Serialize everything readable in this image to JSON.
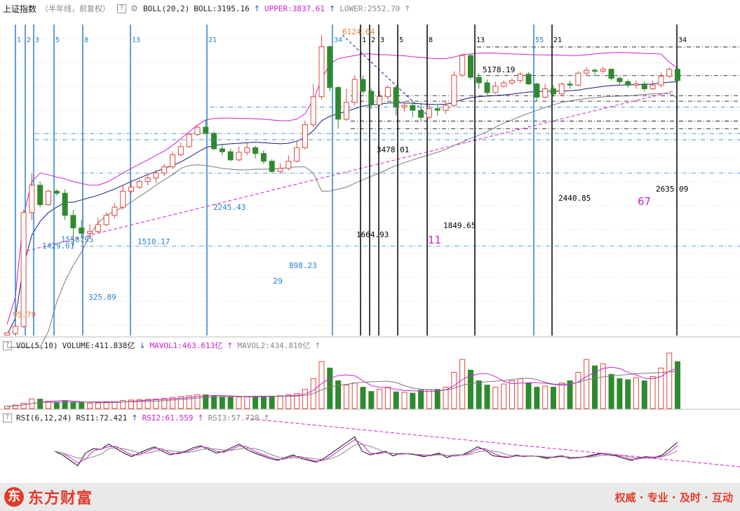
{
  "main_header": {
    "title": "上证指数",
    "subtitle": "（半年线，前复权）",
    "help": "?",
    "indicator": "BOLL(20,2)",
    "boll": "BOLL:3195.16",
    "upper": "UPPER:3837.61",
    "lower": "LOWER:2552.70"
  },
  "vol_header": {
    "help": "?",
    "indicator": "VOL(5,10)",
    "volume": "VOLUME:411.838亿",
    "mavol1": "MAVOL1:463.613亿",
    "mavol2": "MAVOL2:434.810亿"
  },
  "rsi_header": {
    "help": "?",
    "indicator": "RSI(6,12,24)",
    "rsi1": "RSI1:72.421",
    "rsi2": "RSI2:61.559",
    "rsi3": "RSI3:57.728"
  },
  "footer": {
    "logo_mark": "东",
    "brand": "东方财富",
    "slogan": "权威 · 专业 · 及时 · 互动"
  },
  "colors": {
    "up": "#e0473d",
    "down": "#2f8a2f",
    "boll_mid": "#1a1a7a",
    "boll_upper": "#d01fd0",
    "boll_lower": "#7a7a7a",
    "fib_blue": "#2a7fd0",
    "fib_black": "#000000",
    "hline_cyan": "#2a7fd0",
    "trend_pink": "#d01fd0",
    "annot_red": "#e87a30"
  },
  "chart_data": {
    "type": "candlestick",
    "price_scale": [
      100,
      7000
    ],
    "candles": [
      [
        95,
        98,
        97,
        95,
        103
      ],
      [
        97,
        107,
        96,
        108,
        160
      ],
      [
        107,
        520,
        105,
        540,
        250
      ],
      [
        520,
        760,
        470,
        900,
        450
      ],
      [
        760,
        580,
        560,
        800,
        440
      ],
      [
        580,
        700,
        575,
        710,
        340
      ],
      [
        700,
        680,
        660,
        720,
        300
      ],
      [
        680,
        500,
        470,
        720,
        360
      ],
      [
        500,
        420,
        326,
        540,
        300
      ],
      [
        420,
        390,
        360,
        470,
        280
      ],
      [
        390,
        400,
        370,
        440,
        250
      ],
      [
        400,
        440,
        390,
        480,
        260
      ],
      [
        440,
        500,
        430,
        520,
        300
      ],
      [
        500,
        560,
        480,
        590,
        320
      ],
      [
        560,
        700,
        540,
        760,
        380
      ],
      [
        700,
        740,
        680,
        820,
        400
      ],
      [
        740,
        800,
        720,
        830,
        420
      ],
      [
        800,
        840,
        760,
        890,
        430
      ],
      [
        840,
        900,
        780,
        940,
        440
      ],
      [
        900,
        980,
        860,
        1020,
        470
      ],
      [
        980,
        1160,
        950,
        1210,
        520
      ],
      [
        1160,
        1300,
        1130,
        1380,
        560
      ],
      [
        1300,
        1540,
        1280,
        1580,
        600
      ],
      [
        1540,
        1700,
        1500,
        1760,
        650
      ],
      [
        1700,
        1560,
        1540,
        1900,
        640
      ],
      [
        1560,
        1260,
        1240,
        1600,
        590
      ],
      [
        1260,
        1210,
        1150,
        1330,
        560
      ],
      [
        1210,
        1080,
        1060,
        1260,
        530
      ],
      [
        1080,
        1200,
        1060,
        1300,
        540
      ],
      [
        1200,
        1280,
        1150,
        1360,
        550
      ],
      [
        1280,
        1180,
        1100,
        1310,
        560
      ],
      [
        1180,
        1060,
        1020,
        1240,
        580
      ],
      [
        1060,
        920,
        898,
        1090,
        580
      ],
      [
        920,
        960,
        890,
        1030,
        600
      ],
      [
        960,
        1060,
        930,
        1150,
        640
      ],
      [
        1060,
        1280,
        1040,
        1400,
        700
      ],
      [
        1280,
        1760,
        1250,
        1860,
        900
      ],
      [
        1760,
        2600,
        1700,
        3100,
        1400
      ],
      [
        2600,
        5200,
        2500,
        6124,
        2200
      ],
      [
        5200,
        2950,
        2800,
        5300,
        1900
      ],
      [
        2950,
        1900,
        1664,
        3000,
        1300
      ],
      [
        1900,
        2400,
        1850,
        2900,
        1100
      ],
      [
        2400,
        3300,
        2300,
        3500,
        1200
      ],
      [
        3300,
        2800,
        2700,
        3478,
        1000
      ],
      [
        2800,
        2320,
        2200,
        2900,
        800
      ],
      [
        2320,
        2600,
        2280,
        2800,
        900
      ],
      [
        2600,
        2950,
        2500,
        3050,
        1000
      ],
      [
        2950,
        2250,
        2000,
        3000,
        780
      ],
      [
        2250,
        2300,
        2100,
        2450,
        760
      ],
      [
        2300,
        2150,
        1950,
        2450,
        720
      ],
      [
        2150,
        1950,
        1850,
        2400,
        860
      ],
      [
        1950,
        2200,
        1900,
        2350,
        880
      ],
      [
        2200,
        2150,
        2000,
        2300,
        900
      ],
      [
        2150,
        2300,
        2050,
        2450,
        1000
      ],
      [
        2300,
        3500,
        2250,
        3700,
        1700
      ],
      [
        3500,
        4600,
        3400,
        4700,
        2300
      ],
      [
        4600,
        3400,
        3300,
        4700,
        1800
      ],
      [
        3400,
        3150,
        2900,
        3600,
        1300
      ],
      [
        3150,
        2750,
        2650,
        3300,
        1100
      ],
      [
        2750,
        3000,
        2700,
        3200,
        1000
      ],
      [
        3000,
        3150,
        2950,
        3250,
        1150
      ],
      [
        3150,
        3250,
        3050,
        3350,
        1300
      ],
      [
        3250,
        3550,
        3150,
        3650,
        1400
      ],
      [
        3550,
        3100,
        3050,
        3650,
        1200
      ],
      [
        3100,
        2580,
        2440,
        3150,
        1000
      ],
      [
        2580,
        2900,
        2550,
        3100,
        1050
      ],
      [
        2900,
        2700,
        2600,
        3050,
        1000
      ],
      [
        2700,
        3100,
        2650,
        3150,
        1200
      ],
      [
        3100,
        3050,
        2900,
        3250,
        1300
      ],
      [
        3050,
        3600,
        3000,
        3700,
        1700
      ],
      [
        3600,
        3750,
        3450,
        3900,
        2300
      ],
      [
        3750,
        3700,
        3450,
        3850,
        2000
      ],
      [
        3700,
        3800,
        3600,
        3950,
        2100
      ],
      [
        3800,
        3350,
        3250,
        3850,
        1600
      ],
      [
        3350,
        3200,
        3050,
        3450,
        1400
      ],
      [
        3200,
        3050,
        2950,
        3300,
        1350
      ],
      [
        3050,
        3100,
        2900,
        3250,
        1450
      ],
      [
        3100,
        2900,
        2800,
        3200,
        1300
      ],
      [
        2900,
        3050,
        2850,
        3250,
        1500
      ],
      [
        3050,
        3450,
        2950,
        3650,
        1900
      ],
      [
        3450,
        3800,
        3350,
        3900,
        2600
      ],
      [
        3800,
        3250,
        3200,
        3850,
        2200
      ]
    ],
    "boll_mid": [
      95,
      120,
      250,
      380,
      460,
      520,
      560,
      600,
      600,
      620,
      640,
      660,
      690,
      720,
      760,
      800,
      840,
      880,
      920,
      960,
      1000,
      1050,
      1120,
      1200,
      1280,
      1320,
      1340,
      1350,
      1360,
      1370,
      1380,
      1370,
      1360,
      1350,
      1360,
      1400,
      1480,
      1620,
      1860,
      1980,
      2050,
      2120,
      2200,
      2280,
      2320,
      2340,
      2380,
      2390,
      2380,
      2370,
      2350,
      2340,
      2330,
      2340,
      2400,
      2500,
      2560,
      2600,
      2620,
      2640,
      2660,
      2690,
      2730,
      2770,
      2790,
      2800,
      2800,
      2810,
      2820,
      2850,
      2900,
      2950,
      3000,
      3030,
      3050,
      3060,
      3070,
      3080,
      3100,
      3140,
      3180,
      3195
    ],
    "boll_upper": [
      110,
      160,
      500,
      800,
      900,
      880,
      850,
      830,
      800,
      780,
      760,
      760,
      790,
      840,
      900,
      960,
      1020,
      1080,
      1150,
      1220,
      1320,
      1450,
      1600,
      1750,
      1880,
      1920,
      1930,
      1930,
      1920,
      1920,
      1910,
      1900,
      1880,
      1860,
      1860,
      1900,
      2050,
      2500,
      3300,
      4100,
      4400,
      4500,
      4600,
      4700,
      4700,
      4650,
      4650,
      4600,
      4580,
      4520,
      4480,
      4430,
      4400,
      4400,
      4500,
      4650,
      4700,
      4750,
      4760,
      4750,
      4720,
      4700,
      4680,
      4660,
      4650,
      4640,
      4640,
      4620,
      4600,
      4600,
      4650,
      4700,
      4750,
      4780,
      4800,
      4780,
      4760,
      4740,
      4720,
      4700,
      4200,
      3837
    ],
    "boll_lower": [
      80,
      80,
      80,
      80,
      80,
      100,
      150,
      200,
      250,
      300,
      380,
      450,
      500,
      530,
      560,
      600,
      650,
      700,
      760,
      820,
      880,
      960,
      1000,
      1010,
      1000,
      980,
      960,
      950,
      940,
      940,
      950,
      950,
      950,
      960,
      970,
      980,
      980,
      900,
      700,
      700,
      720,
      740,
      780,
      820,
      860,
      900,
      950,
      1000,
      1040,
      1080,
      1120,
      1160,
      1200,
      1250,
      1320,
      1380,
      1460,
      1520,
      1600,
      1700,
      1800,
      1880,
      1980,
      2060,
      2150,
      2240,
      2320,
      2400,
      2450,
      2500,
      2530,
      2560,
      2590,
      2610,
      2620,
      2630,
      2650,
      2680,
      2700,
      2710,
      2720,
      2552
    ],
    "fib_blue_lines": [
      1,
      2,
      3,
      5,
      8,
      13,
      21,
      34,
      55
    ],
    "fib_blue_positions": [
      22,
      36,
      48,
      77,
      118,
      186,
      295,
      474,
      761
    ],
    "fib_black_lines": [
      1,
      2,
      3,
      5,
      8,
      13,
      21,
      34
    ],
    "fib_black_positions": [
      514,
      527,
      540,
      567,
      609,
      677,
      787,
      965
    ],
    "price_labels": [
      "95.79",
      "325.89",
      "898.23",
      "1429.01",
      "1558.95",
      "1510.17",
      "2245.43",
      "6124.04",
      "1664.93",
      "3478.01",
      "1849.65",
      "5178.19",
      "2440.85",
      "2635.09"
    ],
    "count_labels": [
      "29",
      "11",
      "67"
    ],
    "vol_scale_max": 2700,
    "rsi_values": [
      62,
      58,
      52,
      46,
      60,
      65,
      64,
      70,
      65,
      60,
      56,
      60,
      64,
      67,
      62,
      58,
      60,
      62,
      66,
      68,
      64,
      60,
      62,
      66,
      70,
      64,
      60,
      57,
      54,
      52,
      55,
      58,
      54,
      52,
      50,
      54,
      60,
      66,
      72,
      78,
      62,
      58,
      60,
      62,
      57,
      60,
      59,
      58,
      56,
      58,
      60,
      55,
      58,
      58,
      62,
      67,
      63,
      57,
      56,
      55,
      58,
      56,
      57,
      56,
      54,
      56,
      57,
      54,
      55,
      56,
      58,
      60,
      58,
      57,
      54,
      52,
      55,
      56,
      55,
      58,
      65,
      72
    ]
  }
}
